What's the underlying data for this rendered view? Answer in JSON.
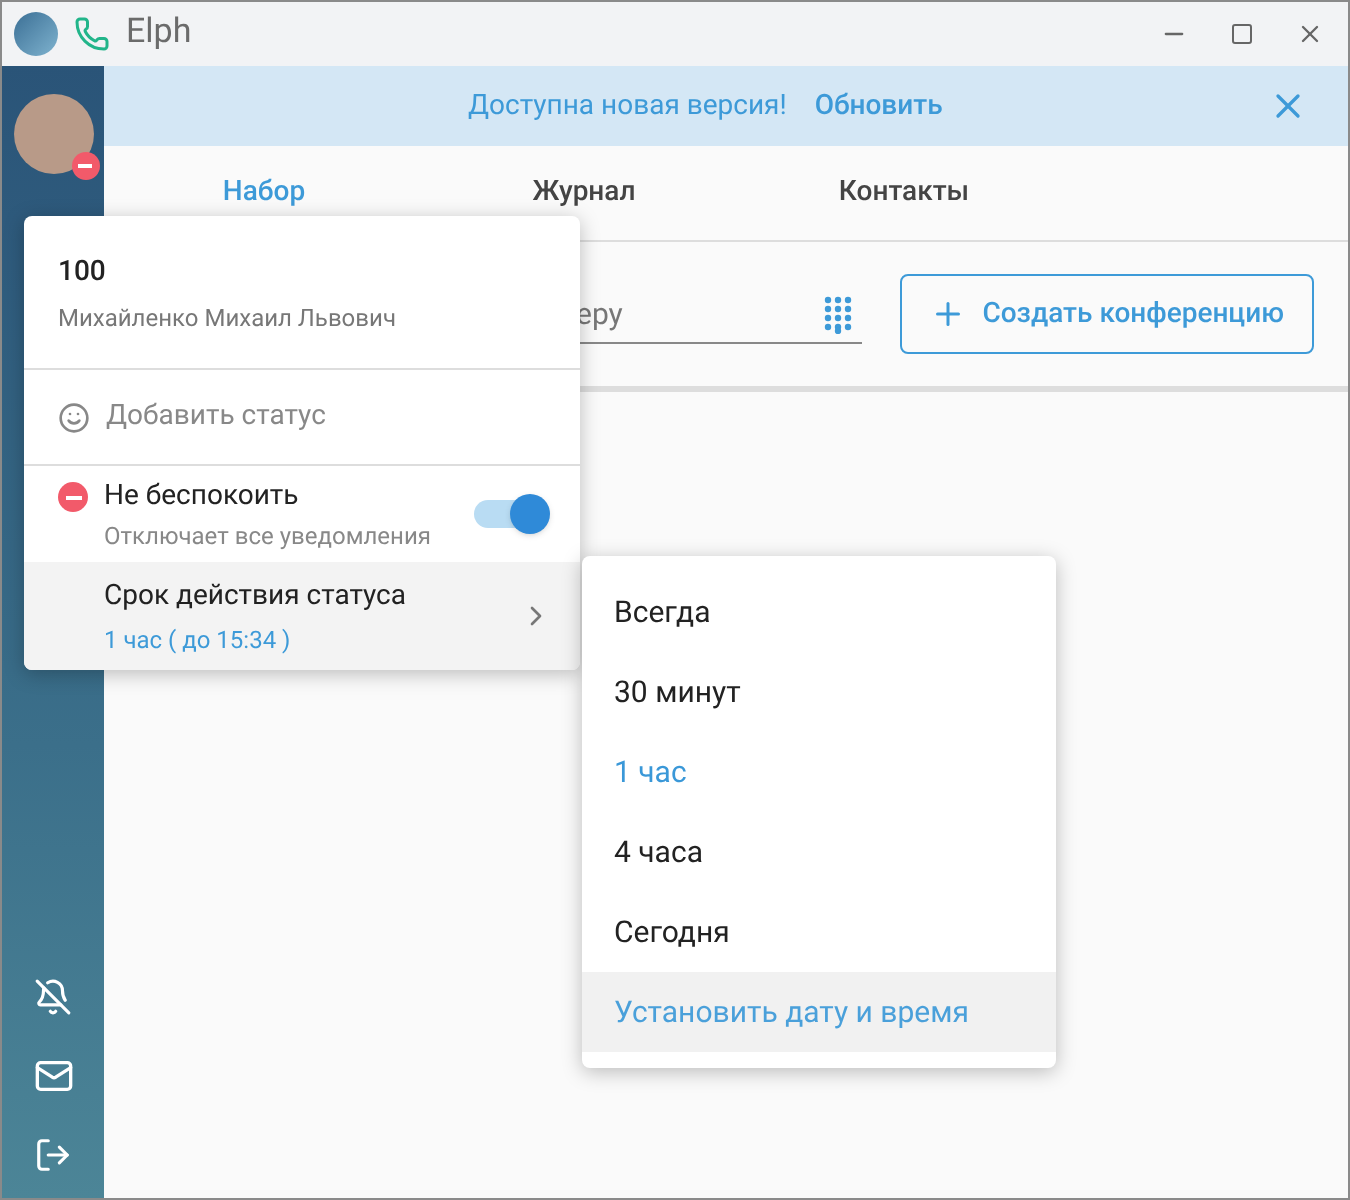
{
  "window": {
    "title": "Elph"
  },
  "banner": {
    "text": "Доступна новая версия!",
    "action": "Обновить"
  },
  "tabs": [
    {
      "label": "Набор",
      "selected": true
    },
    {
      "label": "Журнал",
      "selected": false
    },
    {
      "label": "Контакты",
      "selected": false
    }
  ],
  "search": {
    "placeholder": "еру"
  },
  "conference_button": "Создать конференцию",
  "profile_menu": {
    "number": "100",
    "name": "Михайленко Михаил Львович",
    "add_status": "Добавить статус",
    "dnd": {
      "label": "Не беспокоить",
      "hint": "Отключает все уведомления",
      "on": true
    },
    "expiry": {
      "label": "Срок действия статуса",
      "value": "1 час ( до 15:34 )",
      "highlighted": true
    }
  },
  "expiry_menu": [
    {
      "label": "Всегда",
      "selected": false,
      "highlighted": false
    },
    {
      "label": "30 минут",
      "selected": false,
      "highlighted": false
    },
    {
      "label": "1 час",
      "selected": true,
      "highlighted": false
    },
    {
      "label": "4 часа",
      "selected": false,
      "highlighted": false
    },
    {
      "label": "Сегодня",
      "selected": false,
      "highlighted": false
    },
    {
      "label": "Установить дату и время",
      "selected": false,
      "highlighted": true
    }
  ]
}
